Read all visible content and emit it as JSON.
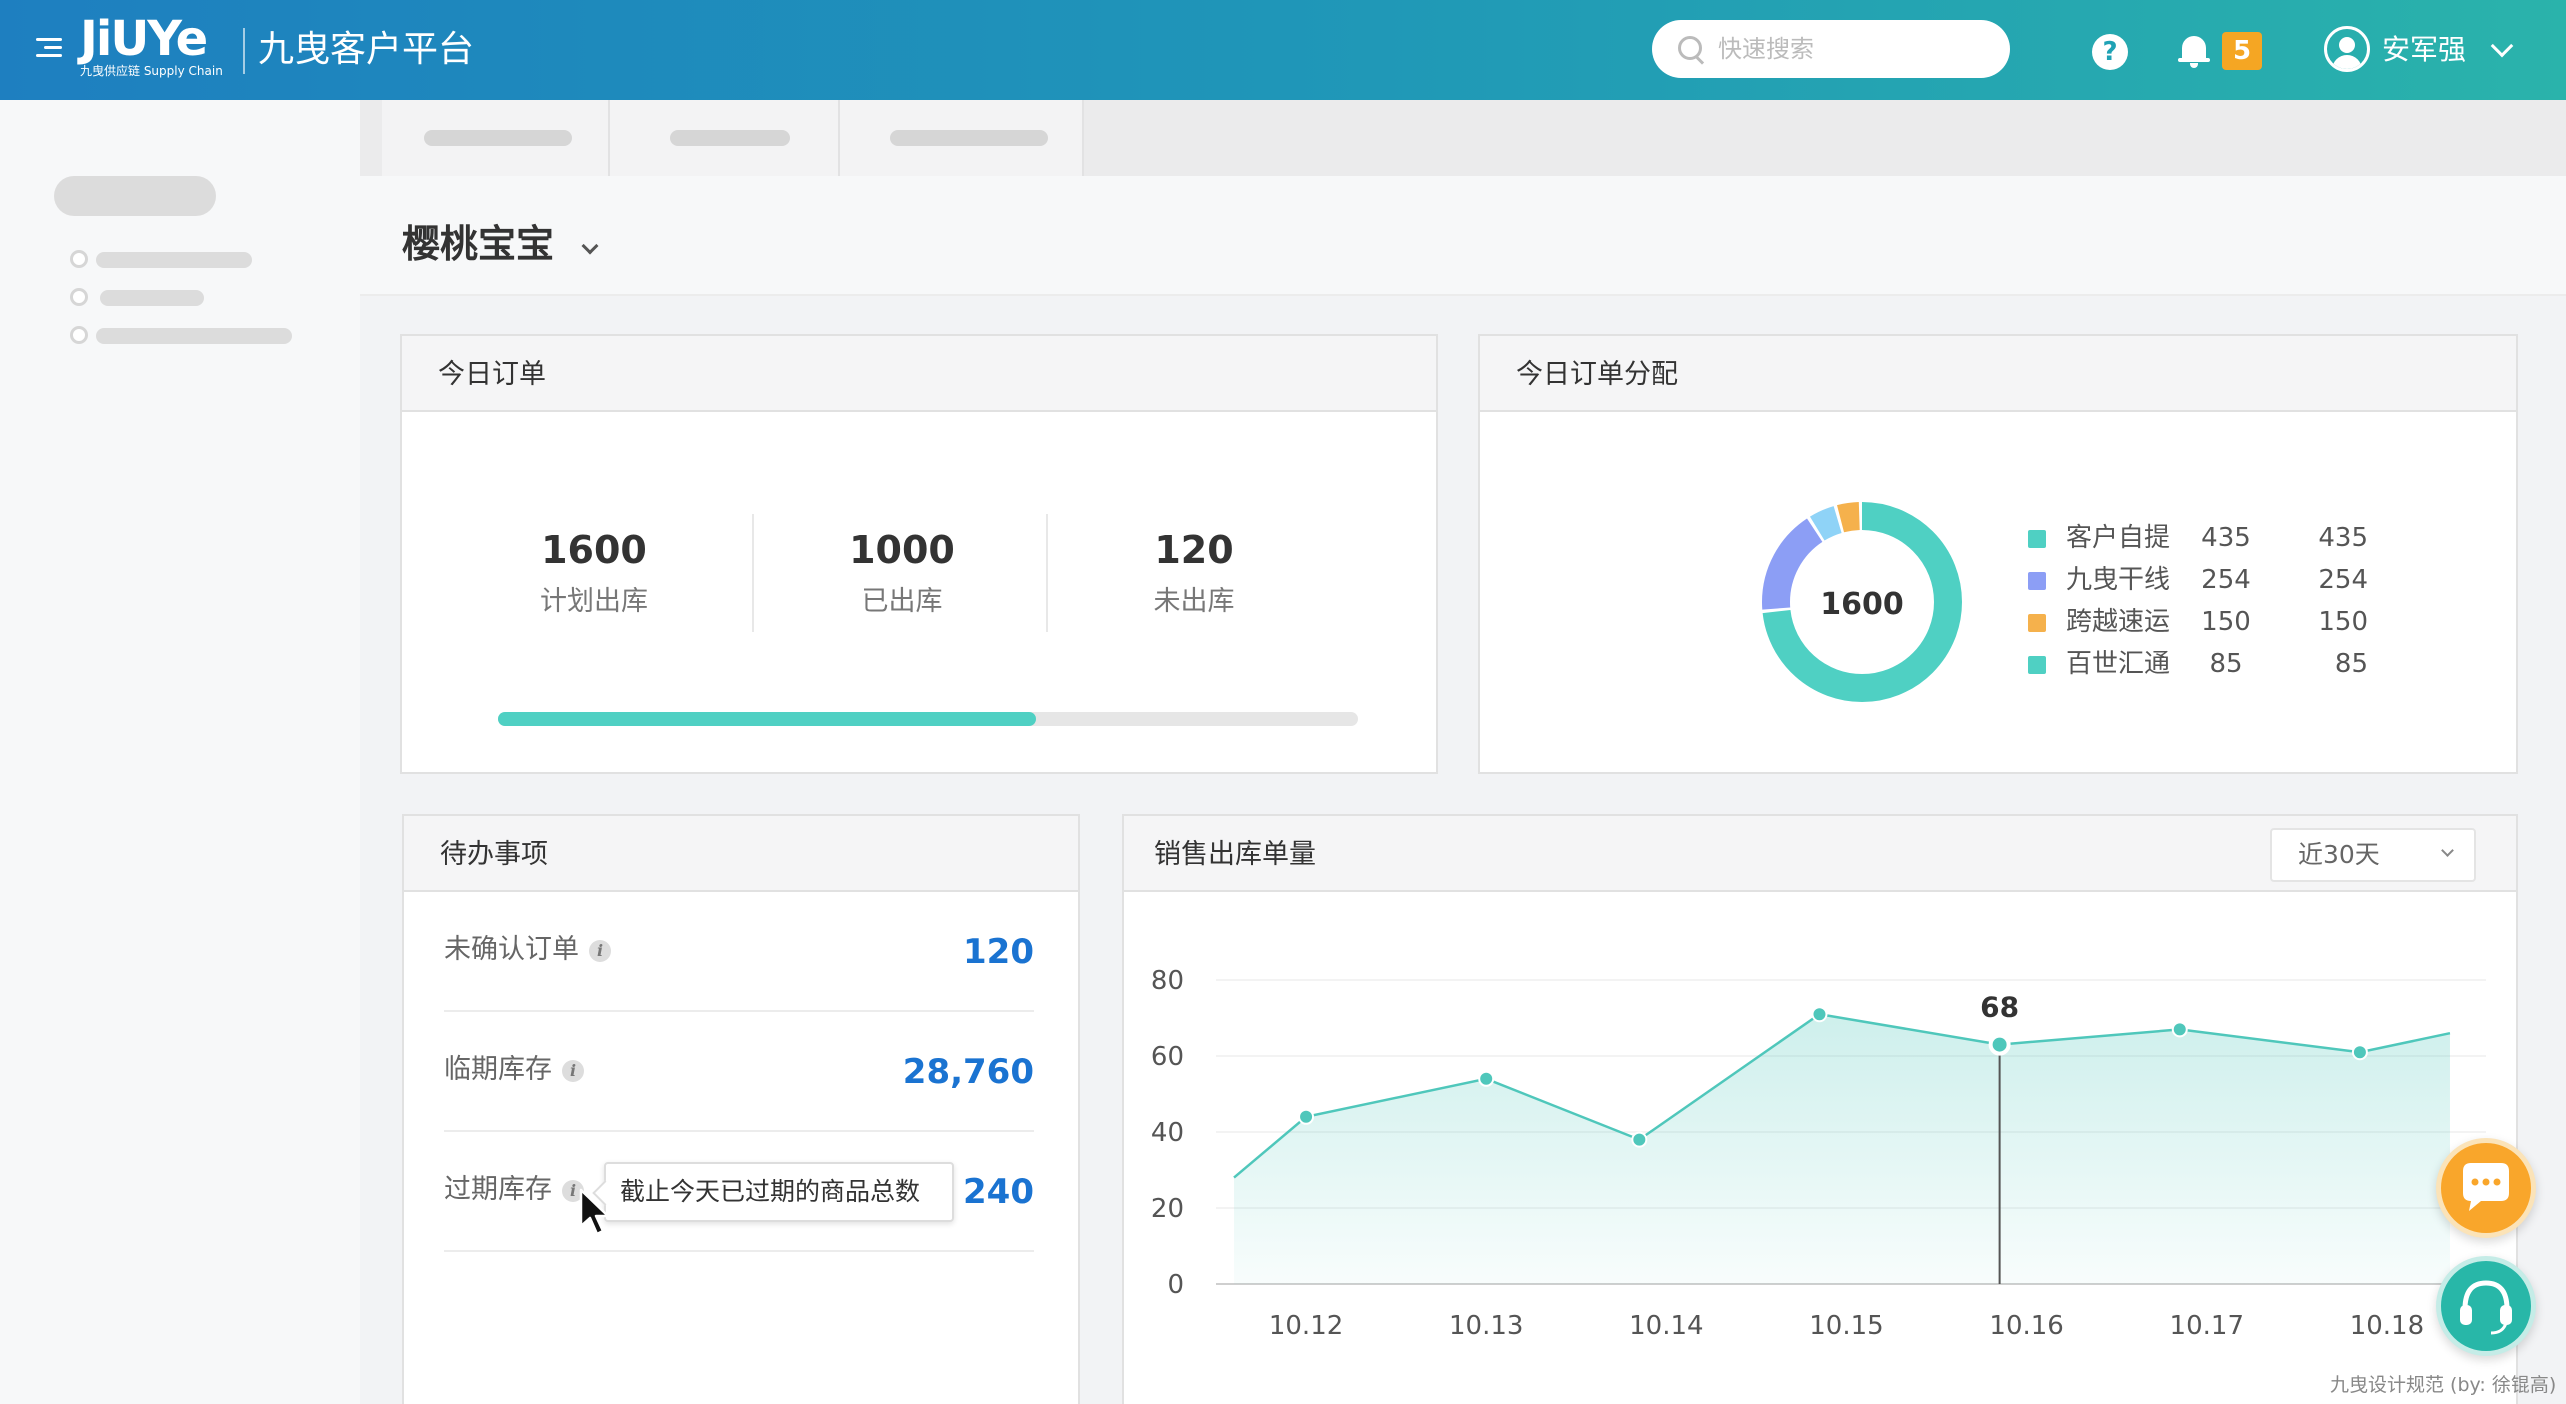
{
  "header": {
    "logo_text": "JiUYe",
    "logo_sub": "九曳供应链 Supply Chain",
    "platform_title": "九曳客户平台",
    "search_placeholder": "快速搜索",
    "notification_count": "5",
    "user_name": "安军强"
  },
  "page": {
    "title": "樱桃宝宝"
  },
  "today_orders": {
    "title": "今日订单",
    "stats": [
      {
        "value": "1600",
        "label": "计划出库"
      },
      {
        "value": "1000",
        "label": "已出库"
      },
      {
        "value": "120",
        "label": "未出库"
      }
    ],
    "progress": 0.625
  },
  "distribution": {
    "title": "今日订单分配",
    "center_value": "1600",
    "items": [
      {
        "name": "客户自提",
        "v1": "435",
        "v2": "435",
        "value": 435,
        "color": "#4fd0c3"
      },
      {
        "name": "九曳干线",
        "v1": "254",
        "v2": "254",
        "value": 254,
        "color": "#8c9ef5"
      },
      {
        "name": "跨越速运",
        "v1": "150",
        "v2": "150",
        "value": 150,
        "color": "#f5b14c"
      },
      {
        "name": "百世汇通",
        "v1": "85",
        "v2": "85",
        "value": 85,
        "color": "#4fd0c3"
      }
    ],
    "donut_segments": [
      {
        "value": 1180,
        "color": "#4fd0c3"
      },
      {
        "value": 280,
        "color": "#8c9ef5"
      },
      {
        "value": 75,
        "color": "#8fd3f7"
      },
      {
        "value": 65,
        "color": "#f5b14c"
      }
    ]
  },
  "todo": {
    "title": "待办事项",
    "items": [
      {
        "label": "未确认订单",
        "value": "120"
      },
      {
        "label": "临期库存",
        "value": "28,760"
      },
      {
        "label": "过期库存",
        "value": "240"
      }
    ],
    "tooltip": "截止今天已过期的商品总数"
  },
  "sales": {
    "title": "销售出库单量",
    "range": "近30天"
  },
  "chart_data": {
    "type": "area",
    "x_ticks": [
      "10.12",
      "10.13",
      "10.14",
      "10.15",
      "10.16",
      "10.17",
      "10.18"
    ],
    "y_ticks": [
      "0",
      "20",
      "40",
      "60",
      "80"
    ],
    "ylim": [
      0,
      80
    ],
    "points": [
      {
        "x": 11.6,
        "y": 28
      },
      {
        "x": 12.0,
        "y": 44
      },
      {
        "x": 13.0,
        "y": 54
      },
      {
        "x": 13.85,
        "y": 38
      },
      {
        "x": 14.85,
        "y": 71
      },
      {
        "x": 15.85,
        "y": 63
      },
      {
        "x": 16.85,
        "y": 67
      },
      {
        "x": 17.85,
        "y": 61
      },
      {
        "x": 18.35,
        "y": 66
      }
    ],
    "highlight": {
      "x": 15.85,
      "label": "68"
    },
    "line_color": "#4fc7bb",
    "grid": "horizontal"
  },
  "watermark": "九曳设计规范 (by: 徐锟高)"
}
